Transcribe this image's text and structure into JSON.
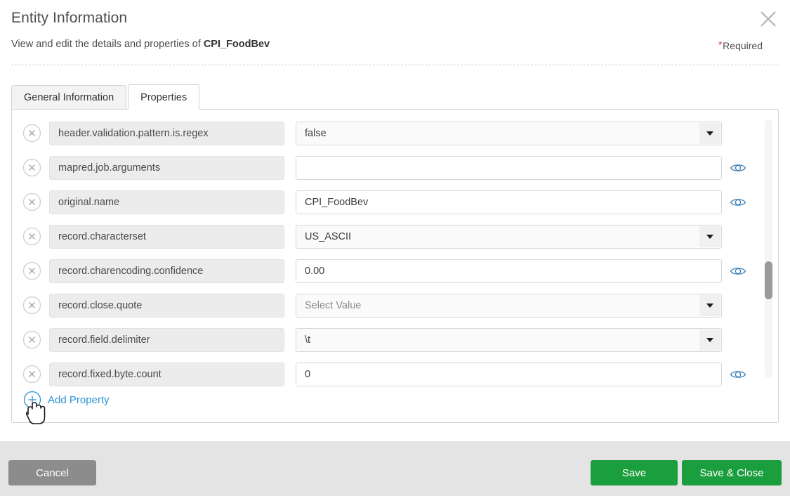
{
  "header": {
    "title": "Entity Information",
    "subtitle_prefix": "View and edit the details and properties of ",
    "entity_name": "CPI_FoodBev",
    "required_star": "*",
    "required_label": "Required",
    "close_icon": "close-icon"
  },
  "tabs": [
    {
      "label": "General Information",
      "active": false
    },
    {
      "label": "Properties",
      "active": true
    }
  ],
  "properties": {
    "rows": [
      {
        "name": "header.validation.pattern.is.regex",
        "value": "false",
        "control": "select",
        "placeholder": false,
        "eye": false
      },
      {
        "name": "mapred.job.arguments",
        "value": "",
        "control": "input",
        "placeholder": false,
        "eye": true
      },
      {
        "name": "original.name",
        "value": "CPI_FoodBev",
        "control": "input",
        "placeholder": false,
        "eye": true
      },
      {
        "name": "record.characterset",
        "value": "US_ASCII",
        "control": "select",
        "placeholder": false,
        "eye": false
      },
      {
        "name": "record.charencoding.confidence",
        "value": "0.00",
        "control": "input",
        "placeholder": false,
        "eye": true
      },
      {
        "name": "record.close.quote",
        "value": "Select Value",
        "control": "select",
        "placeholder": true,
        "eye": false
      },
      {
        "name": "record.field.delimiter",
        "value": "\\t",
        "control": "select",
        "placeholder": false,
        "eye": false
      },
      {
        "name": "record.fixed.byte.count",
        "value": "0",
        "control": "input",
        "placeholder": false,
        "eye": true
      }
    ],
    "add_property_label": "Add Property",
    "add_property_icon": "plus-circle-icon",
    "delete_icon": "remove-circle-icon",
    "reveal_icon": "eye-icon"
  },
  "footer": {
    "cancel_label": "Cancel",
    "save_label": "Save",
    "save_close_label": "Save & Close"
  },
  "colors": {
    "link_blue": "#2a93d5",
    "save_green": "#1a9e3e",
    "cancel_gray": "#8c8c8c",
    "required_red": "#c8202e"
  }
}
